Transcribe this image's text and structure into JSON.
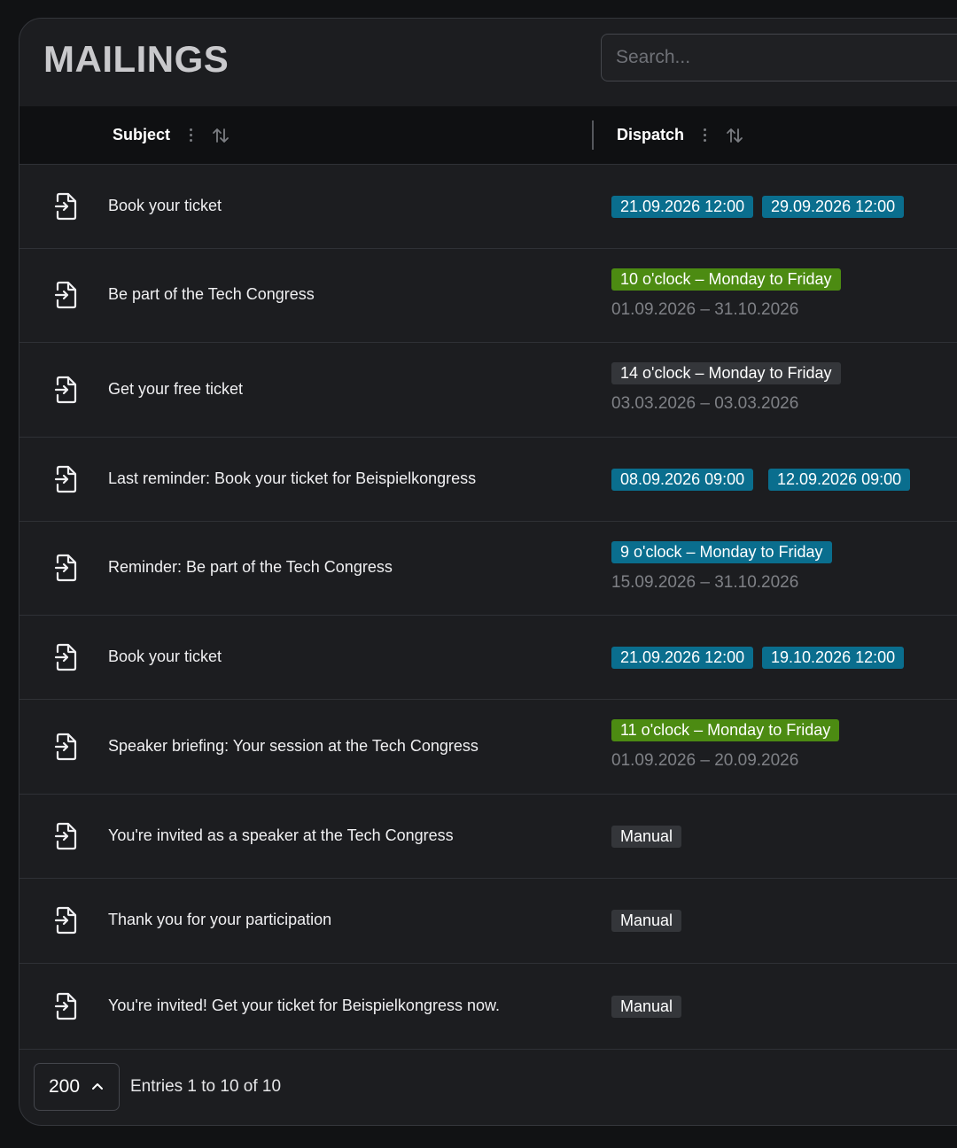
{
  "title": "MAILINGS",
  "search": {
    "placeholder": "Search..."
  },
  "columns": {
    "subject": "Subject",
    "dispatch": "Dispatch"
  },
  "rows": [
    {
      "subject": "Book your ticket",
      "chips": [
        {
          "text": "21.09.2026 12:00",
          "color": "blue"
        },
        {
          "text": "29.09.2026 12:00",
          "color": "blue"
        }
      ]
    },
    {
      "subject": "Be part of the Tech Congress",
      "chips": [
        {
          "text": "10 o'clock – Monday to Friday",
          "color": "green"
        }
      ],
      "range": "01.09.2026 – 31.10.2026"
    },
    {
      "subject": "Get your free ticket",
      "chips": [
        {
          "text": "14 o'clock – Monday to Friday",
          "color": "gray"
        }
      ],
      "range": "03.03.2026 – 03.03.2026"
    },
    {
      "subject": "Last reminder: Book your ticket for Beispielkongress",
      "chips": [
        {
          "text": "08.09.2026 09:00",
          "color": "blue"
        },
        {
          "text": "12.09.2026 09:00",
          "color": "blue"
        }
      ]
    },
    {
      "subject": "Reminder: Be part of the Tech Congress",
      "chips": [
        {
          "text": "9 o'clock – Monday to Friday",
          "color": "blue"
        }
      ],
      "range": "15.09.2026 – 31.10.2026"
    },
    {
      "subject": "Book your ticket",
      "chips": [
        {
          "text": "21.09.2026 12:00",
          "color": "blue"
        },
        {
          "text": "19.10.2026 12:00",
          "color": "blue"
        }
      ]
    },
    {
      "subject": "Speaker briefing: Your session at the Tech Congress",
      "chips": [
        {
          "text": "11 o'clock – Monday to Friday",
          "color": "green"
        }
      ],
      "range": "01.09.2026 – 20.09.2026"
    },
    {
      "subject": "You're invited as a speaker at the Tech Congress",
      "chips": [
        {
          "text": "Manual",
          "color": "gray"
        }
      ]
    },
    {
      "subject": "Thank you for your participation",
      "chips": [
        {
          "text": "Manual",
          "color": "gray"
        }
      ]
    },
    {
      "subject": "You're invited! Get your ticket for Beispielkongress now.",
      "chips": [
        {
          "text": "Manual",
          "color": "gray"
        }
      ]
    }
  ],
  "footer": {
    "page_size": "200",
    "entries": "Entries 1 to 10 of 10"
  },
  "colors": {
    "blue_chip": "#0a6e8e",
    "green_chip": "#4c8b12",
    "gray_chip": "#34363a",
    "background": "#1c1d20"
  }
}
